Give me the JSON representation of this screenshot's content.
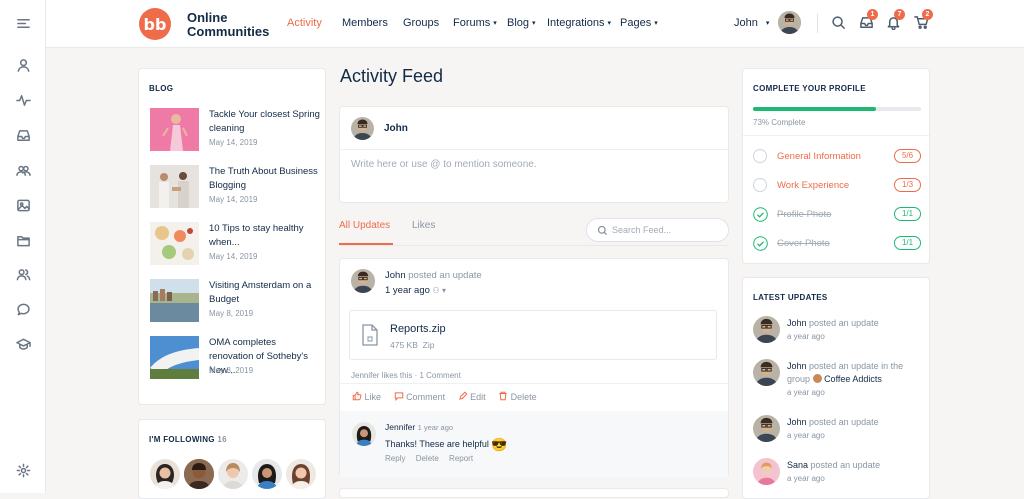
{
  "header": {
    "brand_line1": "Online",
    "brand_line2": "Communities",
    "logo_text": "bb",
    "nav": [
      {
        "label": "Activity",
        "active": true,
        "dropdown": false
      },
      {
        "label": "Members",
        "dropdown": false
      },
      {
        "label": "Groups",
        "dropdown": false
      },
      {
        "label": "Forums",
        "dropdown": true
      },
      {
        "label": "Blog",
        "dropdown": true
      },
      {
        "label": "Integrations",
        "dropdown": true
      },
      {
        "label": "Pages",
        "dropdown": true
      }
    ],
    "user_name": "John",
    "badges": {
      "messages": "1",
      "notifications": "7",
      "cart": "2"
    }
  },
  "colors": {
    "accent": "#ef6c4a",
    "green": "#1db973",
    "text": "#122b46"
  },
  "blog": {
    "title": "BLOG",
    "posts": [
      {
        "title": "Tackle Your closest Spring cleaning",
        "date": "May 14, 2019"
      },
      {
        "title": "The Truth About Business Blogging",
        "date": "May 14, 2019"
      },
      {
        "title": "10 Tips to stay healthy when...",
        "date": "May 14, 2019"
      },
      {
        "title": "Visiting Amsterdam on a Budget",
        "date": "May 8, 2019"
      },
      {
        "title": "OMA completes renovation of Sotheby's New...",
        "date": "May 8, 2019"
      }
    ]
  },
  "following": {
    "title": "I'M FOLLOWING",
    "count": "16"
  },
  "feed": {
    "title": "Activity Feed",
    "composer_name": "John",
    "composer_placeholder": "Write here or use @ to mention someone.",
    "tabs": [
      "All Updates",
      "Likes"
    ],
    "search_placeholder": "Search Feed...",
    "post": {
      "author": "John",
      "action": "posted an update",
      "time": "1 year ago",
      "file_name": "Reports.zip",
      "file_size": "475 KB",
      "file_type": "Zip",
      "likes_text": "Jennifer likes this",
      "comments_count": "· 1 Comment",
      "actions": [
        "Like",
        "Comment",
        "Edit",
        "Delete"
      ],
      "comment": {
        "author": "Jennifer",
        "time": "1 year ago",
        "text": "Thanks! These are helpful",
        "emoji": "😎",
        "actions": [
          "Reply",
          "Delete",
          "Report"
        ]
      }
    }
  },
  "profile": {
    "title": "COMPLETE YOUR PROFILE",
    "progress": 0.73,
    "progress_label": "73% Complete",
    "items": [
      {
        "label": "General Information",
        "count": "5/6",
        "done": false
      },
      {
        "label": "Work Experience",
        "count": "1/3",
        "done": false
      },
      {
        "label": "Profile Photo",
        "count": "1/1",
        "done": true
      },
      {
        "label": "Cover Photo",
        "count": "1/1",
        "done": true
      }
    ]
  },
  "updates": {
    "title": "LATEST UPDATES",
    "items": [
      {
        "name": "John",
        "action": "posted an update",
        "time": "a year ago"
      },
      {
        "name": "John",
        "action": "posted an update in the group",
        "group": "Coffee Addicts",
        "time": "a year ago"
      },
      {
        "name": "John",
        "action": "posted an update",
        "time": "a year ago"
      },
      {
        "name": "Sana",
        "action": "posted an update",
        "time": "a year ago"
      }
    ]
  }
}
